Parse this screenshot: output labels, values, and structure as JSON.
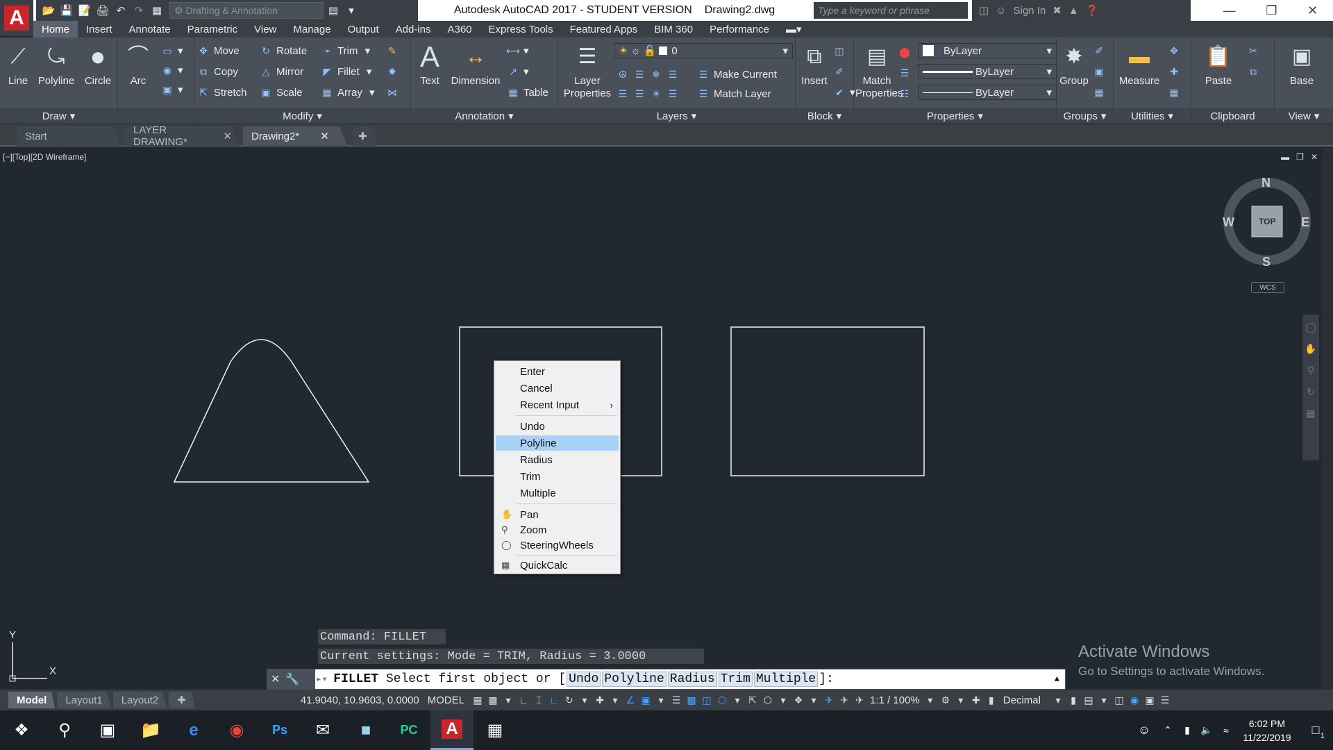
{
  "titlebar": {
    "app_title": "Autodesk AutoCAD 2017 - STUDENT VERSION",
    "file_name": "Drawing2.dwg",
    "workspace": "Drafting & Annotation",
    "search_placeholder": "Type a keyword or phrase",
    "sign_in": "Sign In"
  },
  "menu_tabs": [
    "Home",
    "Insert",
    "Annotate",
    "Parametric",
    "View",
    "Manage",
    "Output",
    "Add-ins",
    "A360",
    "Express Tools",
    "Featured Apps",
    "BIM 360",
    "Performance"
  ],
  "ribbon": {
    "draw": {
      "title": "Draw",
      "line": "Line",
      "polyline": "Polyline",
      "circle": "Circle",
      "arc": "Arc"
    },
    "modify": {
      "title": "Modify",
      "move": "Move",
      "rotate": "Rotate",
      "trim": "Trim",
      "copy": "Copy",
      "mirror": "Mirror",
      "fillet": "Fillet",
      "stretch": "Stretch",
      "scale": "Scale",
      "array": "Array"
    },
    "annotation": {
      "title": "Annotation",
      "text": "Text",
      "dimension": "Dimension",
      "table": "Table"
    },
    "layers": {
      "title": "Layers",
      "layer_properties_1": "Layer",
      "layer_properties_2": "Properties",
      "current_layer": "0",
      "make_current": "Make Current",
      "match_layer": "Match Layer"
    },
    "block": {
      "title": "Block",
      "insert": "Insert"
    },
    "properties": {
      "title": "Properties",
      "match_1": "Match",
      "match_2": "Properties",
      "color": "ByLayer",
      "lineweight": "ByLayer",
      "linetype": "ByLayer"
    },
    "groups": {
      "title": "Groups",
      "group": "Group"
    },
    "utilities": {
      "title": "Utilities",
      "measure": "Measure"
    },
    "clipboard": {
      "title": "Clipboard",
      "paste": "Paste"
    },
    "view": {
      "title": "View",
      "base": "Base"
    }
  },
  "doc_tabs": [
    "Start",
    "LAYER DRAWING*",
    "Drawing2*"
  ],
  "viewport": {
    "label": "[−][Top][2D Wireframe]",
    "compass": {
      "n": "N",
      "s": "S",
      "e": "E",
      "w": "W",
      "center": "TOP",
      "ucs": "WCS"
    },
    "ucs_x": "X",
    "ucs_y": "Y"
  },
  "context_menu": {
    "items": [
      "Enter",
      "Cancel",
      "Recent Input",
      "Undo",
      "Polyline",
      "Radius",
      "Trim",
      "Multiple",
      "Pan",
      "Zoom",
      "SteeringWheels",
      "QuickCalc"
    ],
    "highlighted": "Polyline"
  },
  "command": {
    "history_1": "Command: FILLET",
    "history_2": "Current settings: Mode = TRIM, Radius = 3.0000",
    "name": "FILLET",
    "prompt": "Select first object or [",
    "options": [
      "Undo",
      "Polyline",
      "Radius",
      "Trim",
      "Multiple"
    ],
    "suffix": "]:"
  },
  "watermark": {
    "title": "Activate Windows",
    "subtitle": "Go to Settings to activate Windows."
  },
  "statusbar": {
    "layout_tabs": [
      "Model",
      "Layout1",
      "Layout2"
    ],
    "coordinates": "41.9040, 10.9603, 0.0000",
    "space": "MODEL",
    "scale": "1:1 / 100%",
    "units": "Decimal"
  },
  "taskbar": {
    "time": "6:02 PM",
    "date": "11/22/2019",
    "notifications": "1"
  }
}
